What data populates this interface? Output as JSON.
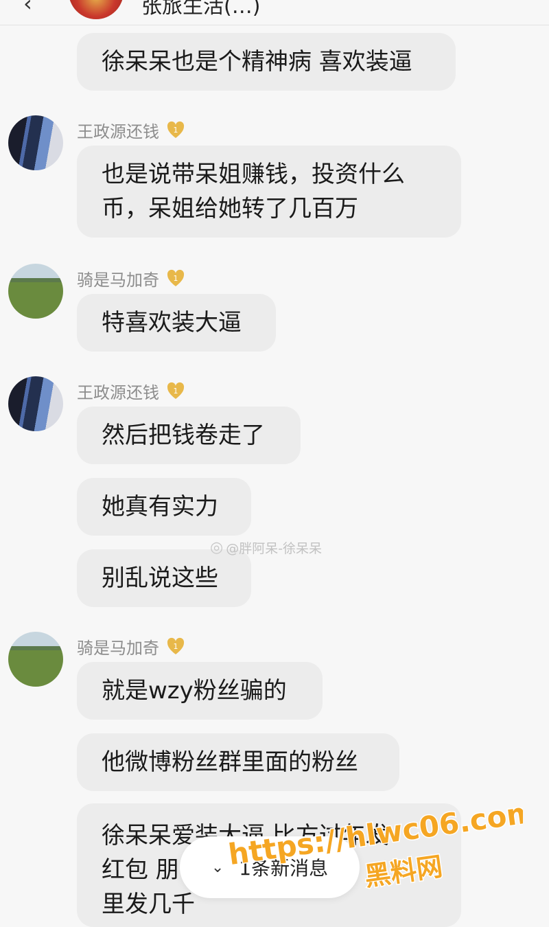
{
  "header": {
    "back_icon": "chevron-left-icon",
    "title": "张旅生活(…)"
  },
  "messages": [
    {
      "sender": null,
      "bubbles": [
        "徐呆呆也是个精神病 喜欢装逼"
      ]
    },
    {
      "sender": "王政源还钱",
      "badge_level": "1",
      "bubbles": [
        "也是说带呆姐赚钱，投资什么",
        "币，呆姐给她转了几百万"
      ]
    },
    {
      "sender": "骑是马加奇",
      "badge_level": "1",
      "bubbles": [
        "特喜欢装大逼"
      ]
    },
    {
      "sender": "王政源还钱",
      "badge_level": "1",
      "bubbles": [
        "然后把钱卷走了",
        "她真有实力",
        "别乱说这些"
      ]
    },
    {
      "sender": "骑是马加奇",
      "badge_level": "1",
      "bubbles": [
        "就是wzy粉丝骗的",
        "他微博粉丝群里面的粉丝",
        "徐呆呆爱装大逼 比方过年发",
        "红包 朋",
        "里发几千"
      ]
    }
  ],
  "watermark": "@胖阿呆-徐呆呆",
  "new_message_pill": {
    "label": "1条新消息",
    "icon": "chevron-double-down-icon"
  },
  "overlay_stamp": {
    "url": "https://hlwc06.com",
    "brand": "黑料网",
    "color": "#f5a623"
  },
  "colors": {
    "bubble": "#ececec",
    "background": "#f7f7f7",
    "badge": "#e8b84a"
  }
}
